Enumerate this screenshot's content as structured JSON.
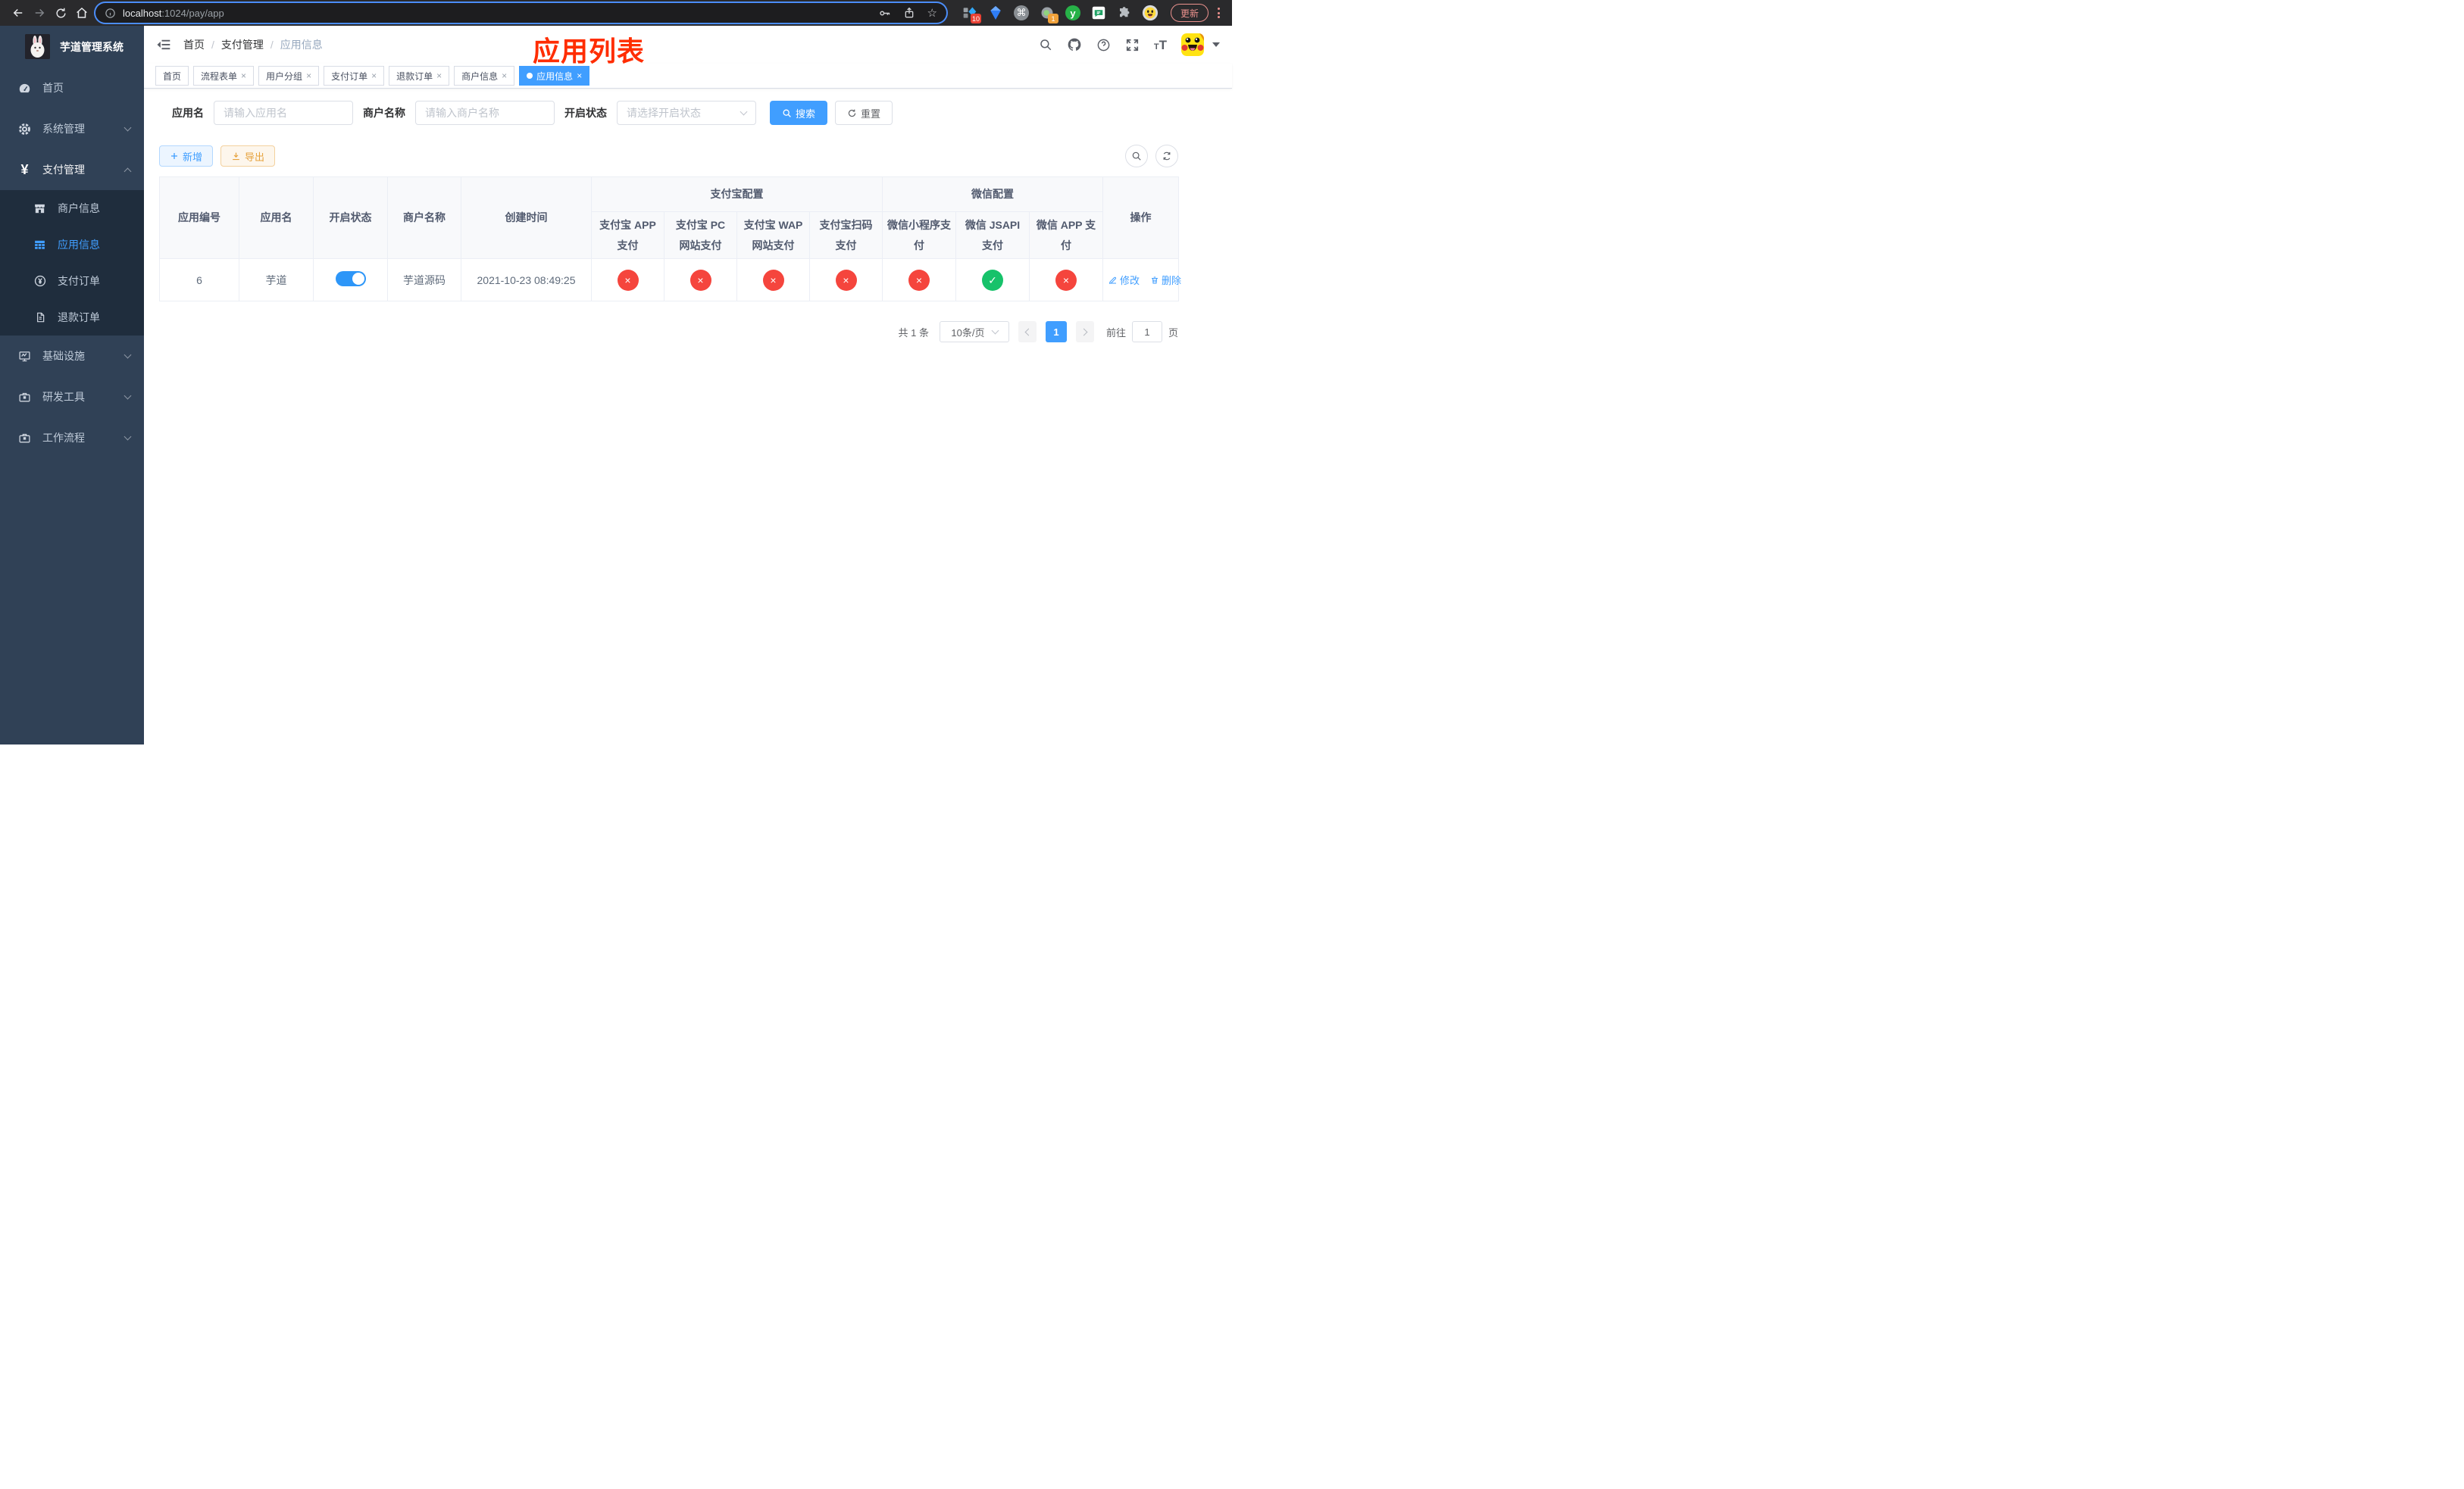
{
  "browser": {
    "url_host": "localhost",
    "url_path": ":1024/pay/app",
    "update_label": "更新",
    "ext_badges": {
      "devtools": "10",
      "tree": "1"
    },
    "ext_y_label": "y"
  },
  "icons": {
    "close": "×",
    "separator": "/",
    "star": "☆",
    "command": "⌘",
    "yen": "¥"
  },
  "sidebar": {
    "title": "芋道管理系统",
    "items": [
      {
        "label": "首页"
      },
      {
        "label": "系统管理"
      },
      {
        "label": "支付管理"
      },
      {
        "label": "基础设施"
      },
      {
        "label": "研发工具"
      },
      {
        "label": "工作流程"
      }
    ],
    "pay_children": [
      {
        "label": "商户信息"
      },
      {
        "label": "应用信息"
      },
      {
        "label": "支付订单"
      },
      {
        "label": "退款订单"
      }
    ]
  },
  "header": {
    "breadcrumb": [
      "首页",
      "支付管理",
      "应用信息"
    ],
    "overlay_title": "应用列表"
  },
  "tabs": [
    {
      "label": "首页"
    },
    {
      "label": "流程表单"
    },
    {
      "label": "用户分组"
    },
    {
      "label": "支付订单"
    },
    {
      "label": "退款订单"
    },
    {
      "label": "商户信息"
    },
    {
      "label": "应用信息"
    }
  ],
  "filters": {
    "app_name": {
      "label": "应用名",
      "placeholder": "请输入应用名",
      "value": ""
    },
    "merchant_name": {
      "label": "商户名称",
      "placeholder": "请输入商户名称",
      "value": ""
    },
    "status": {
      "label": "开启状态",
      "placeholder": "请选择开启状态",
      "value": ""
    },
    "search_label": "搜索",
    "reset_label": "重置"
  },
  "toolbar": {
    "add_label": "新增",
    "export_label": "导出"
  },
  "table": {
    "columns": [
      "应用编号",
      "应用名",
      "开启状态",
      "商户名称",
      "创建时间"
    ],
    "groups": {
      "alipay": "支付宝配置",
      "wechat": "微信配置"
    },
    "sub_columns": [
      "支付宝 APP 支付",
      "支付宝 PC 网站支付",
      "支付宝 WAP 网站支付",
      "支付宝扫码支付",
      "微信小程序支付",
      "微信 JSAPI 支付",
      "微信 APP 支付"
    ],
    "actions_column": "操作",
    "row": {
      "app_id": "6",
      "app_name": "芋道",
      "status_state": "on",
      "merchant_name": "芋道源码",
      "create_time": "2021-10-23 08:49:25",
      "configs": [
        {
          "name": "alipay-app-pay",
          "state": "fail",
          "glyph": "×"
        },
        {
          "name": "alipay-pc-pay",
          "state": "fail",
          "glyph": "×"
        },
        {
          "name": "alipay-wap-pay",
          "state": "fail",
          "glyph": "×"
        },
        {
          "name": "alipay-qr-pay",
          "state": "fail",
          "glyph": "×"
        },
        {
          "name": "wechat-mini-pay",
          "state": "fail",
          "glyph": "×"
        },
        {
          "name": "wechat-jsapi-pay",
          "state": "pass",
          "glyph": "✓"
        },
        {
          "name": "wechat-app-pay",
          "state": "fail",
          "glyph": "×"
        }
      ],
      "actions": [
        {
          "label": "修改"
        },
        {
          "label": "删除"
        }
      ]
    }
  },
  "pagination": {
    "total": "共 1 条",
    "page_size": "10条/页",
    "current_page": "1",
    "goto_label": "前往",
    "goto_value": "1",
    "page_label": "页"
  }
}
